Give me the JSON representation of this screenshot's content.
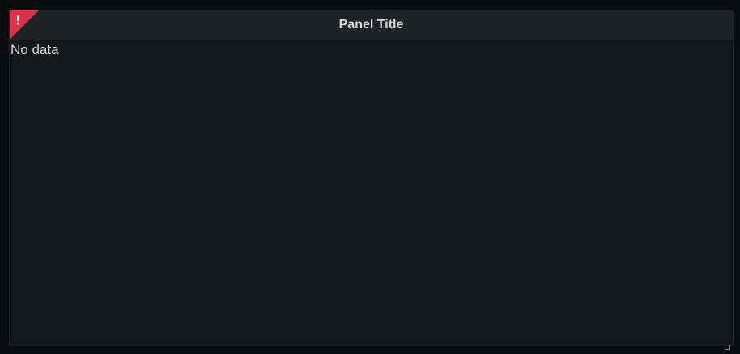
{
  "panel": {
    "title": "Panel Title",
    "error_icon": "exclamation-icon",
    "error_glyph": "!",
    "body_text": "No data",
    "colors": {
      "page_bg": "#0b0c0e",
      "panel_bg": "#161719",
      "header_bg": "#202226",
      "error": "#e02f44",
      "text": "#d8d9da"
    }
  }
}
